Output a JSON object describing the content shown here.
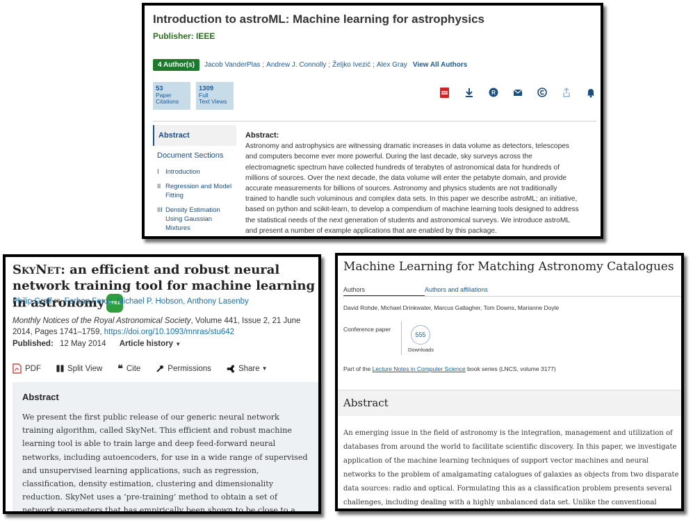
{
  "ieee": {
    "title": "Introduction to astroML: Machine learning for astrophysics",
    "publisher": "Publisher: IEEE",
    "author_count": "4 Author(s)",
    "authors": [
      "Jacob VanderPlas",
      "Andrew J. Connolly",
      "Željko Ivezić",
      "Alex Gray"
    ],
    "separator": ";",
    "view_all": "View All Authors",
    "metrics": [
      {
        "value": "53",
        "line1": "Paper",
        "line2": "Citations"
      },
      {
        "value": "1309",
        "line1": "Full",
        "line2": "Text Views"
      }
    ],
    "action_icons": [
      "pdf-icon",
      "download-icon",
      "rights-icon",
      "email-icon",
      "copyright-icon",
      "share-icon",
      "alert-bell-icon"
    ],
    "sidebar": {
      "active": "Abstract",
      "section_header": "Document Sections",
      "items": [
        {
          "num": "I",
          "label": "Introduction"
        },
        {
          "num": "II",
          "label": "Regression and Model Fitting"
        },
        {
          "num": "III",
          "label": "Density Estimation Using Gaussian Mixtures"
        }
      ]
    },
    "abstract_heading": "Abstract:",
    "abstract_text": "Astronomy and astrophysics are witnessing dramatic increases in data volume as detectors, telescopes and computers become ever more powerful. During the last decade, sky surveys across the electromagnetic spectrum have collected hundreds of terabytes of astronomical data for hundreds of millions of sources. Over the next decade, the data volume will enter the petabyte domain, and provide accurate measurements for billions of sources. Astronomy and physics students are not traditionally trained to handle such voluminous and complex data sets. In this paper we describe astroML; an initiative, based on python and scikit-learn, to develop a compendium of machine learning tools designed to address the statistical needs of the next generation of students and astronomical surveys. We introduce astroML and present a number of example applications that are enabled by this package."
  },
  "mnras": {
    "title_name": "SkyNet",
    "title_rest": ": an efficient and robust neural network training tool for machine learning in astronomy",
    "free_badge": "FREE",
    "authors": [
      "Philip Graff",
      "Farhan Feroz",
      "Michael P. Hobson",
      "Anthony Lasenby"
    ],
    "journal": "Monthly Notices of the Royal Astronomical Society",
    "citation_rest": ", Volume 441, Issue 2, 21 June 2014, Pages 1741–1759,",
    "doi": "https://doi.org/10.1093/mnras/stu642",
    "published_label": "Published:",
    "published_date": "12 May 2014",
    "article_history": "Article history",
    "tools": [
      "PDF",
      "Split View",
      "Cite",
      "Permissions",
      "Share"
    ],
    "abstract_heading": "Abstract",
    "abstract_text": "We present the first public release of our generic neural network training algorithm, called SkyNet. This efficient and robust machine learning tool is able to train large and deep feed-forward neural networks, including autoencoders, for use in a wide range of supervised and unsupervised learning applications, such as regression, classification, density estimation, clustering and dimensionality reduction. SkyNet uses a ‘pre-training’ method to obtain a set of network parameters that has empirically been shown to be close to a good solution, followed by further optimization using a regularized variant of"
  },
  "springer": {
    "title": "Machine Learning for Matching Astronomy Catalogues",
    "tab_authors": "Authors",
    "tab_affiliations": "Authors and affiliations",
    "authors": "David Rohde, Michael Drinkwater, Marcus Gallagher, Tom Downs, Marianne Doyle",
    "conference": "Conference paper",
    "downloads": "555",
    "downloads_label": "Downloads",
    "series_prefix": "Part of the ",
    "series_link": "Lecture Notes in Computer Science",
    "series_suffix": " book series (LNCS, volume 3177)",
    "abstract_heading": "Abstract",
    "abstract_text": "An emerging issue in the field of astronomy is the integration, management and utilization of databases from around the world to facilitate scientific discovery. In this paper, we investigate application of the machine learning techniques of support vector machines and neural networks to the problem of amalgamating catalogues of galaxies as objects from two disparate data sources: radio and optical. Formulating this as a classification problem presents several challenges, including dealing with a highly unbalanced data set. Unlike the conventional"
  }
}
